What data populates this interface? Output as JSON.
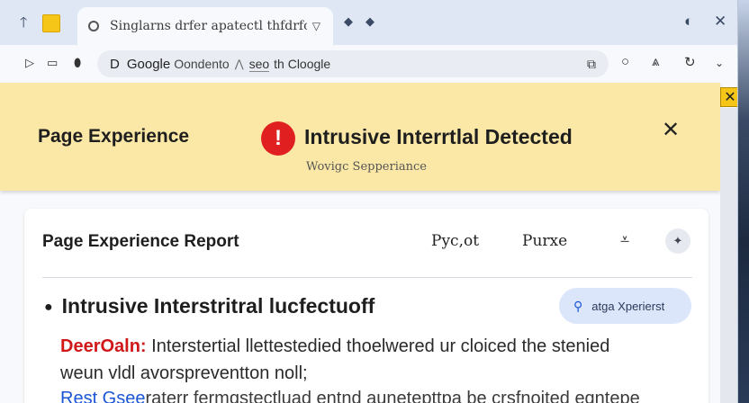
{
  "tab": {
    "title": "Singlarns drfer apatectl thfdrfot",
    "dropdown": "▽"
  },
  "toolbar": {
    "omnibox_prefix": "D",
    "omnibox_brand": "Google",
    "omnibox_brand_rest": "Oondento",
    "omnibox_caret": "⋀",
    "omnibox_search_a": "seo",
    "omnibox_search_b": "th Cloogle"
  },
  "banner": {
    "left_label": "Page Experience",
    "alert_glyph": "!",
    "title": "Intrusive Interrtlal Detected",
    "subtitle": "Wovigc Sepperiance",
    "close_glyph": "✕"
  },
  "side_close": "✕",
  "report": {
    "title": "Page Experience Report",
    "link_1": "Pyc,ot",
    "link_2": "Purxe",
    "item_heading": "Intrusive Interstritral lucfectuoff",
    "pill_text": "atga Xperierst",
    "desc_label": "DeerOaln:",
    "desc_text": " Interstertial llettestedied thoelwered ur cloiced the stenied",
    "desc_text_2": "weun vldl avorspreventton noll;",
    "bottom_blue": "Rest Gsee",
    "bottom_rest": "raterr fermqstectluad entnd aunetepttpa be crsfnoited eqntepe"
  },
  "colors": {
    "banner_bg": "#fbe8a6",
    "alert_red": "#e02020",
    "accent_blue": "#1a56d6",
    "pill_bg": "#dbe6fa"
  }
}
